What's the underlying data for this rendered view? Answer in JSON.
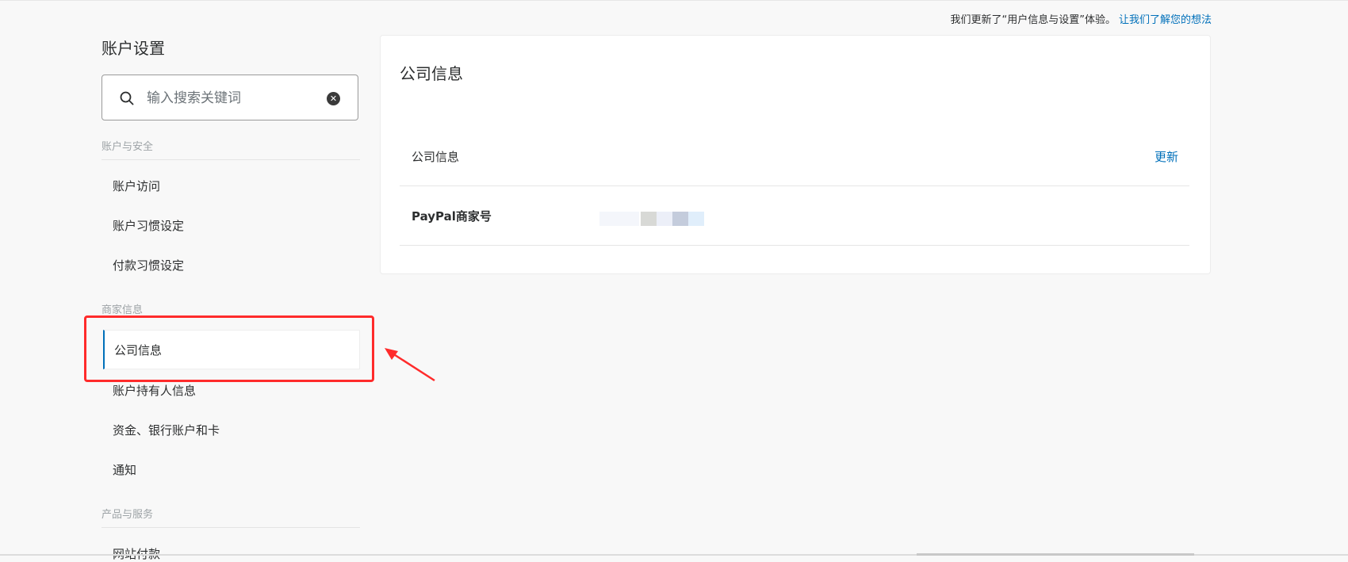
{
  "notice": {
    "text": "我们更新了“用户信息与设置”体验。",
    "link": "让我们了解您的想法"
  },
  "sidebar": {
    "title": "账户设置",
    "search": {
      "placeholder": "输入搜索关键词"
    },
    "sections": [
      {
        "header": "账户与安全",
        "items": [
          "账户访问",
          "账户习惯设定",
          "付款习惯设定"
        ]
      },
      {
        "header": "商家信息",
        "items": [
          "公司信息",
          "账户持有人信息",
          "资金、银行账户和卡",
          "通知"
        ]
      },
      {
        "header": "产品与服务",
        "items": [
          "网站付款"
        ]
      }
    ],
    "active_item": "公司信息"
  },
  "main": {
    "card_title": "公司信息",
    "rows": [
      {
        "label": "公司信息",
        "action": "更新"
      },
      {
        "label": "PayPal商家号"
      }
    ]
  },
  "colors": {
    "link": "#0070ba",
    "highlight": "#ff2b2b",
    "background": "#f8f8f8"
  }
}
